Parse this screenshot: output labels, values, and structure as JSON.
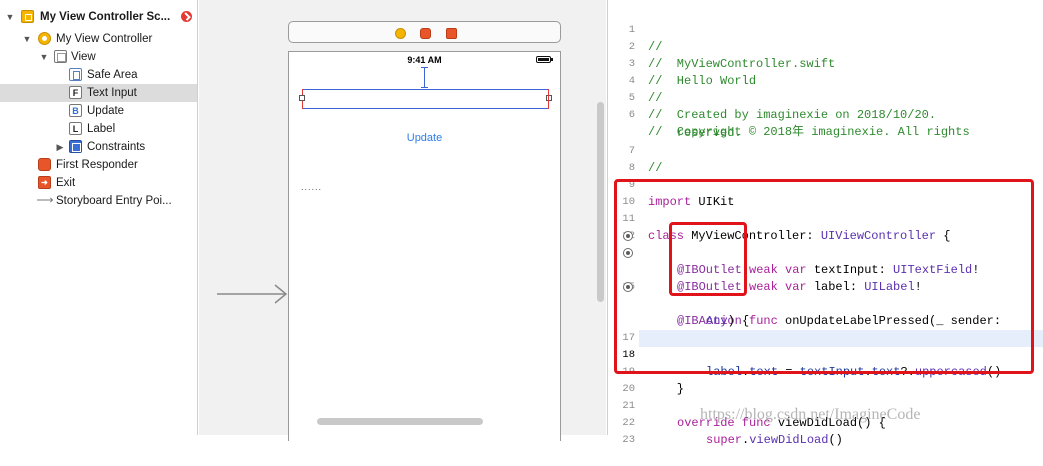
{
  "outline": {
    "scene_title": "My View Controller Sc...",
    "items": [
      {
        "label": "My View Controller"
      },
      {
        "label": "View"
      },
      {
        "label": "Safe Area"
      },
      {
        "label": "Text Input",
        "icon_text": "F"
      },
      {
        "label": "Update",
        "icon_text": "B"
      },
      {
        "label": "Label",
        "icon_text": "L"
      },
      {
        "label": "Constraints"
      },
      {
        "label": "First Responder"
      },
      {
        "label": "Exit"
      },
      {
        "label": "Storyboard Entry Poi..."
      }
    ],
    "selected": "Text Input"
  },
  "canvas": {
    "status_time": "9:41 AM",
    "update_button": "Update",
    "label_placeholder": "......"
  },
  "editor": {
    "current_line": 18,
    "lines": [
      {
        "num": "1",
        "text": "//"
      },
      {
        "num": "2",
        "text": "//  MyViewController.swift"
      },
      {
        "num": "3",
        "text": "//  Hello World"
      },
      {
        "num": "4",
        "text": "//"
      },
      {
        "num": "5",
        "text": "//  Created by imaginexie on 2018/10/20."
      },
      {
        "num": "6",
        "text": "//  Copyright © 2018年 imaginexie. All rights"
      },
      {
        "num": "",
        "text": "    reserved."
      },
      {
        "num": "7",
        "text": "//"
      },
      {
        "num": "8",
        "text": ""
      },
      {
        "num": "9",
        "kw": "import",
        "rest": " UIKit"
      },
      {
        "num": "10",
        "text": ""
      },
      {
        "num": "11",
        "kw": "class",
        "name": " MyViewController: ",
        "type": "UIViewController",
        "end": " {"
      },
      {
        "num": "12",
        "text": ""
      },
      {
        "num": "13",
        "attr": "@IBOutlet",
        "kw": " weak var",
        "name": " textInput: ",
        "type": "UITextField",
        "end": "!"
      },
      {
        "num": "14",
        "attr": "@IBOutlet",
        "kw": " weak var",
        "name": " label: ",
        "type": "UILabel",
        "end": "!"
      },
      {
        "num": "15",
        "text": ""
      },
      {
        "num": "16",
        "attr": "@IBAction",
        "kw": " func",
        "name": " onUpdateLabelPressed(_ sender:"
      },
      {
        "num": "",
        "type": "Any",
        "end": ") {"
      },
      {
        "num": "17",
        "text": ""
      },
      {
        "num": "18",
        "a": "label",
        "b": ".",
        "c": "text",
        "d": " = ",
        "e": "textInput",
        "f": ".",
        "g": "text",
        "h": "?.",
        "i": "uppercased",
        "j": "()"
      },
      {
        "num": "19",
        "text": "    }"
      },
      {
        "num": "20",
        "text": ""
      },
      {
        "num": "21",
        "kw": "override func",
        "name": " viewDidLoad() {"
      },
      {
        "num": "22",
        "kw": "super",
        "name": ".",
        "fn": "viewDidLoad",
        "end": "()"
      },
      {
        "num": "23",
        "text": ""
      }
    ]
  },
  "watermark": "https://blog.csdn.net/ImagineCode",
  "colors": {
    "highlight_box": "#e0121a",
    "selection": "#dcdcdc",
    "current_line": "#e7eefb"
  }
}
